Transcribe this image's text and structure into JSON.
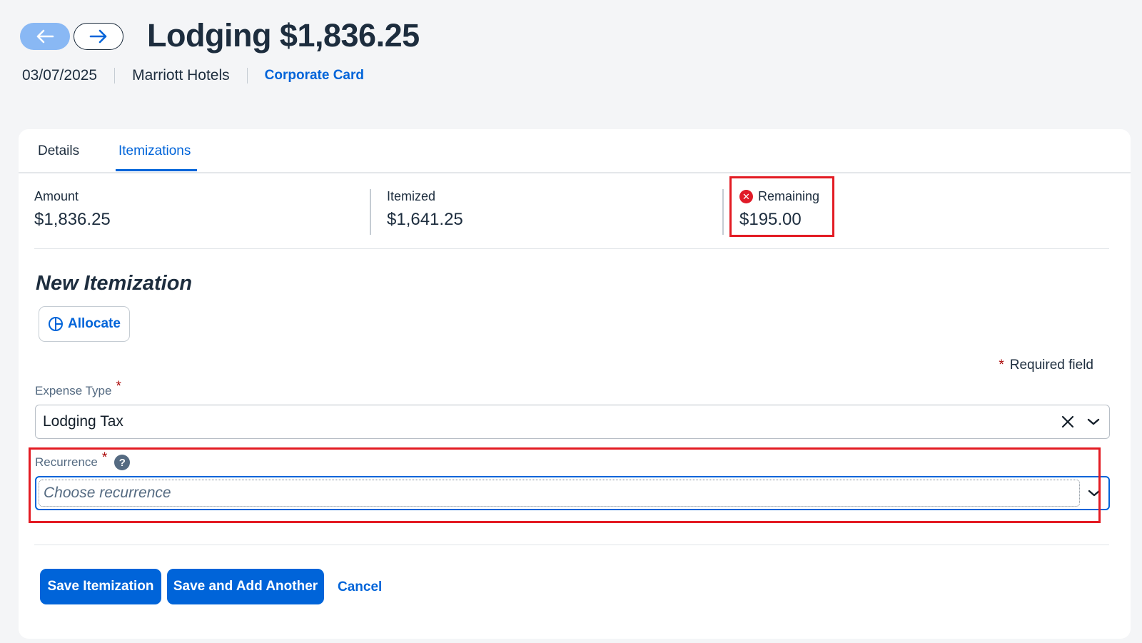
{
  "header": {
    "title": "Lodging $1,836.25",
    "date": "03/07/2025",
    "vendor": "Marriott Hotels",
    "payment_type": "Corporate Card"
  },
  "tabs": [
    {
      "label": "Details",
      "active": false
    },
    {
      "label": "Itemizations",
      "active": true
    }
  ],
  "summary": {
    "amount_label": "Amount",
    "amount_value": "$1,836.25",
    "itemized_label": "Itemized",
    "itemized_value": "$1,641.25",
    "remaining_label": "Remaining",
    "remaining_value": "$195.00"
  },
  "form": {
    "section_title": "New Itemization",
    "allocate_label": "Allocate",
    "required_note": "Required field",
    "required_star": "*",
    "expense_type_label": "Expense Type",
    "expense_type_value": "Lodging Tax",
    "recurrence_label": "Recurrence",
    "recurrence_placeholder": "Choose recurrence"
  },
  "actions": {
    "save": "Save Itemization",
    "save_add": "Save and Add Another",
    "cancel": "Cancel"
  },
  "colors": {
    "accent": "#0064d9",
    "error": "#e01b28",
    "highlight_box": "#e31b23"
  },
  "icons": [
    "arrow-left-icon",
    "arrow-right-icon",
    "error-icon",
    "pie-chart-icon",
    "clear-icon",
    "chevron-down-icon",
    "help-icon"
  ]
}
